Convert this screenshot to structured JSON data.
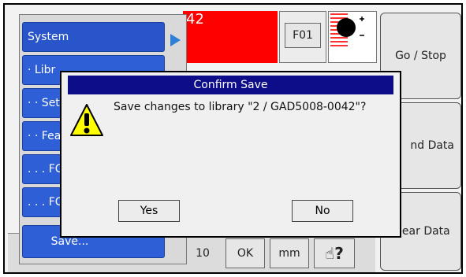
{
  "menu": {
    "items": [
      {
        "label": "System"
      },
      {
        "label": "· Libr"
      },
      {
        "label": "· · Set"
      },
      {
        "label": "· · Fea"
      },
      {
        "label": ". . . FC"
      },
      {
        "label": ". . . FC"
      },
      {
        "label": "Save..."
      }
    ]
  },
  "top": {
    "value": "42",
    "code_button": "F01"
  },
  "right_buttons": {
    "go_stop": "Go / Stop",
    "find_data": "nd Data",
    "clear_data": "Clear Data"
  },
  "bottom": {
    "value": "10",
    "ok": "OK",
    "unit": "mm",
    "help_mark": "?"
  },
  "dialog": {
    "title": "Confirm Save",
    "message": "Save changes to library \"2 / GAD5008-0042\"?",
    "yes": "Yes",
    "no": "No"
  },
  "colors": {
    "menu_blue": "#2f5fd6",
    "title_bar": "#0d0d8a",
    "value_red": "#ff0000",
    "warning_yellow": "#ffff00"
  }
}
